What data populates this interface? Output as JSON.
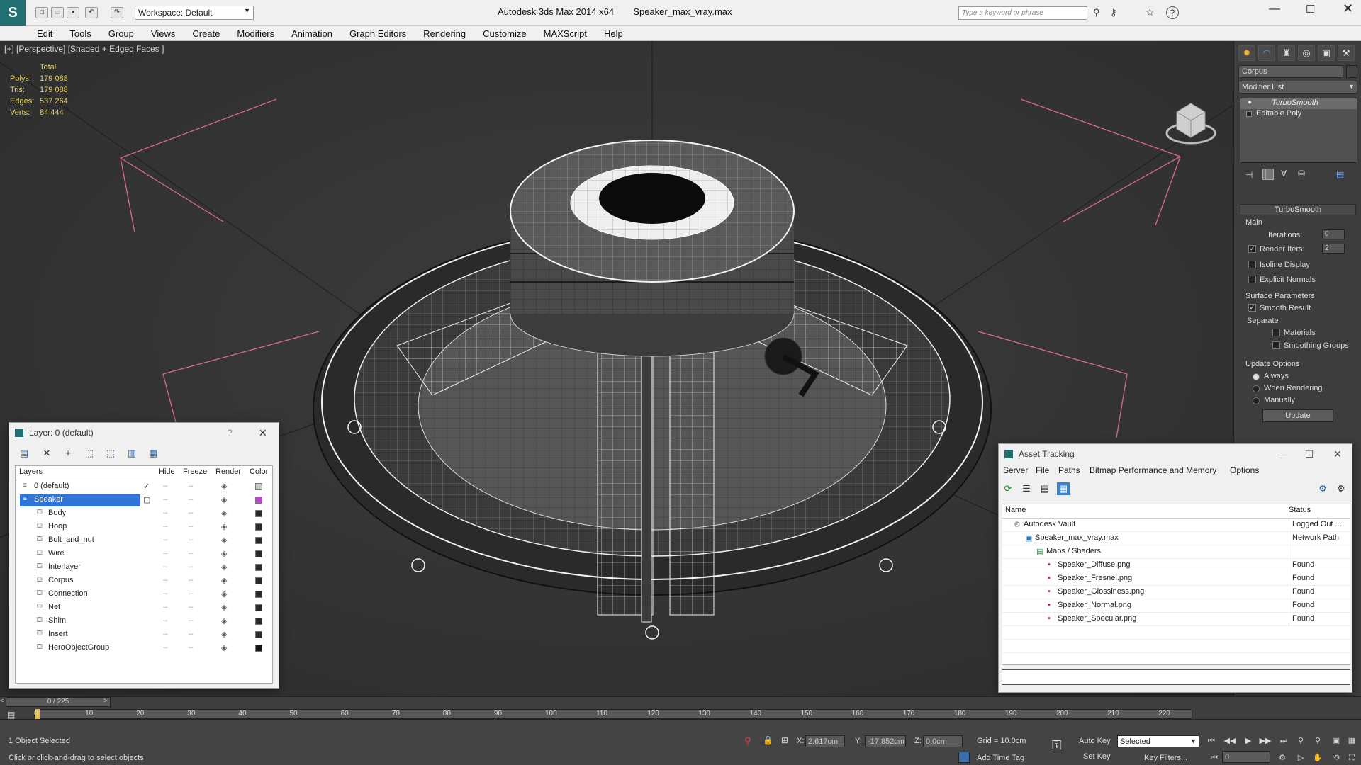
{
  "app": {
    "title": "Autodesk 3ds Max  2014 x64",
    "file": "Speaker_max_vray.max",
    "workspace": "Workspace: Default",
    "search_placeholder": "Type a keyword or phrase"
  },
  "menu": [
    "Edit",
    "Tools",
    "Group",
    "Views",
    "Create",
    "Modifiers",
    "Animation",
    "Graph Editors",
    "Rendering",
    "Customize",
    "MAXScript",
    "Help"
  ],
  "viewport": {
    "label": "[+] [Perspective] [Shaded + Edged Faces ]",
    "stats": {
      "header": "Total",
      "polys_label": "Polys:",
      "polys": "179 088",
      "tris_label": "Tris:",
      "tris": "179 088",
      "edges_label": "Edges:",
      "edges": "537 264",
      "verts_label": "Verts:",
      "verts": "84 444"
    }
  },
  "command_panel": {
    "object_name": "Corpus",
    "modifier_list": "Modifier List",
    "stack": [
      "TurboSmooth",
      "Editable Poly"
    ],
    "turbosmooth": {
      "title": "TurboSmooth",
      "main": "Main",
      "iterations_label": "Iterations:",
      "iterations": "0",
      "render_iters_label": "Render Iters:",
      "render_iters": "2",
      "isoline": "Isoline Display",
      "explicit_normals": "Explicit Normals",
      "surface_params": "Surface Parameters",
      "smooth_result": "Smooth Result",
      "separate": "Separate",
      "materials": "Materials",
      "smoothing_groups": "Smoothing Groups",
      "update_options": "Update Options",
      "always": "Always",
      "when_rendering": "When Rendering",
      "manually": "Manually",
      "update_btn": "Update"
    }
  },
  "layer_window": {
    "title": "Layer: 0 (default)",
    "help": "?",
    "columns": [
      "Layers",
      "Hide",
      "Freeze",
      "Render",
      "Color"
    ],
    "rows": [
      {
        "name": "0 (default)",
        "level": 0,
        "color": "#c8c8c8"
      },
      {
        "name": "Speaker",
        "level": 0,
        "selected": true,
        "color": "#c040d0"
      },
      {
        "name": "Body",
        "level": 1,
        "color": "#2a2a2a"
      },
      {
        "name": "Hoop",
        "level": 1,
        "color": "#2a2a2a"
      },
      {
        "name": "Bolt_and_nut",
        "level": 1,
        "color": "#2a2a2a"
      },
      {
        "name": "Wire",
        "level": 1,
        "color": "#2a2a2a"
      },
      {
        "name": "Interlayer",
        "level": 1,
        "color": "#2a2a2a"
      },
      {
        "name": "Corpus",
        "level": 1,
        "color": "#2a2a2a"
      },
      {
        "name": "Connection",
        "level": 1,
        "color": "#2a2a2a"
      },
      {
        "name": "Net",
        "level": 1,
        "color": "#2a2a2a"
      },
      {
        "name": "Shim",
        "level": 1,
        "color": "#2a2a2a"
      },
      {
        "name": "Insert",
        "level": 1,
        "color": "#2a2a2a"
      },
      {
        "name": "HeroObjectGroup",
        "level": 1,
        "color": "#111111"
      }
    ]
  },
  "asset_window": {
    "title": "Asset Tracking",
    "menu": [
      "Server",
      "File",
      "Paths",
      "Bitmap Performance and Memory",
      "Options"
    ],
    "columns": [
      "Name",
      "Status"
    ],
    "rows": [
      {
        "name": "Autodesk Vault",
        "status": "Logged Out ...",
        "level": 0
      },
      {
        "name": "Speaker_max_vray.max",
        "status": "Network Path",
        "level": 1
      },
      {
        "name": "Maps / Shaders",
        "status": "",
        "level": 2
      },
      {
        "name": "Speaker_Diffuse.png",
        "status": "Found",
        "level": 3
      },
      {
        "name": "Speaker_Fresnel.png",
        "status": "Found",
        "level": 3
      },
      {
        "name": "Speaker_Glossiness.png",
        "status": "Found",
        "level": 3
      },
      {
        "name": "Speaker_Normal.png",
        "status": "Found",
        "level": 3
      },
      {
        "name": "Speaker_Specular.png",
        "status": "Found",
        "level": 3
      }
    ]
  },
  "timeline": {
    "frame": "0 / 225",
    "ticks": [
      "0",
      "10",
      "20",
      "30",
      "40",
      "50",
      "60",
      "70",
      "80",
      "90",
      "100",
      "110",
      "120",
      "130",
      "140",
      "150",
      "160",
      "170",
      "180",
      "190",
      "200",
      "210",
      "220"
    ]
  },
  "statusbar": {
    "selection": "1 Object Selected",
    "prompt": "Click or click-and-drag to select objects",
    "x_label": "X:",
    "x": "2.617cm",
    "y_label": "Y:",
    "y": "-17.852cm",
    "z_label": "Z:",
    "z": "0.0cm",
    "grid": "Grid = 10.0cm",
    "auto_key": "Auto Key",
    "set_key": "Set Key",
    "selected": "Selected",
    "key_filters": "Key Filters...",
    "add_time_tag": "Add Time Tag",
    "current_frame": "0"
  }
}
